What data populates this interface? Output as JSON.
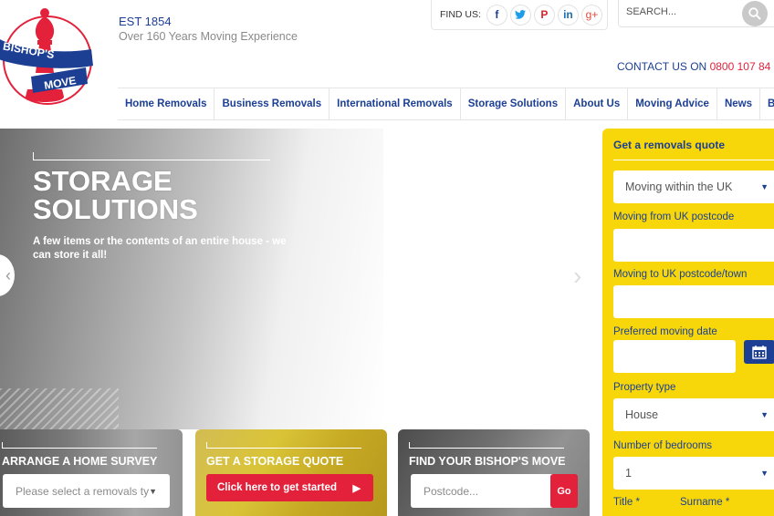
{
  "header": {
    "logo_text": "BISHOP'S MOVE",
    "est": "EST 1854",
    "tagline": "Over 160 Years Moving Experience",
    "find_us_label": "FIND US:",
    "social": [
      {
        "name": "facebook",
        "glyph": "f"
      },
      {
        "name": "twitter",
        "glyph": "🐦"
      },
      {
        "name": "pinterest",
        "glyph": "P"
      },
      {
        "name": "linkedin",
        "glyph": "in"
      },
      {
        "name": "google-plus",
        "glyph": "g+"
      }
    ],
    "search_placeholder": "SEARCH...",
    "contact_label": "CONTACT US ON",
    "contact_phone": "0800 107 84"
  },
  "nav": {
    "items": [
      "Home Removals",
      "Business Removals",
      "International Removals",
      "Storage Solutions",
      "About Us",
      "Moving Advice",
      "News",
      "Blog"
    ]
  },
  "hero": {
    "title": "STORAGE SOLUTIONS",
    "subtitle": "A few items or the contents of an entire house - we can store it all!",
    "prev_glyph": "‹",
    "next_glyph": "›"
  },
  "quote": {
    "title": "Get a removals quote",
    "move_type": "Moving within the UK",
    "from_label": "Moving from UK postcode",
    "to_label": "Moving to UK postcode/town",
    "date_label": "Preferred moving date",
    "property_label": "Property type",
    "property_value": "House",
    "bedrooms_label": "Number of bedrooms",
    "bedrooms_value": "1",
    "title_label": "Title *",
    "surname_label": "Surname *"
  },
  "cards": {
    "survey": {
      "title": "ARRANGE A HOME SURVEY",
      "select_placeholder": "Please select a removals ty"
    },
    "storage": {
      "title": "GET A STORAGE QUOTE",
      "button": "Click here to get started"
    },
    "find": {
      "title": "FIND YOUR BISHOP'S MOVE",
      "input_placeholder": "Postcode...",
      "go": "Go"
    }
  },
  "colors": {
    "brand_blue": "#1c3f94",
    "brand_red": "#e3213b",
    "quote_yellow": "#f7d70a"
  }
}
